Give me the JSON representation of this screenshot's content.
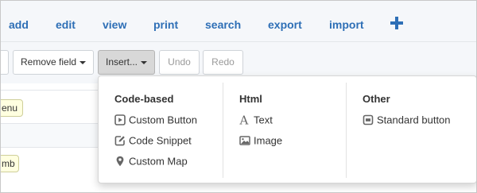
{
  "nav": {
    "items": [
      {
        "label": "add"
      },
      {
        "label": "edit"
      },
      {
        "label": "view"
      },
      {
        "label": "print"
      },
      {
        "label": "search"
      },
      {
        "label": "export"
      },
      {
        "label": "import"
      }
    ],
    "plus_icon": "plus-icon"
  },
  "toolbar": {
    "remove_field_label": "Remove field",
    "insert_label": "Insert...",
    "undo_label": "Undo",
    "redo_label": "Redo"
  },
  "background": {
    "pill1": "enu",
    "pill2": "mb"
  },
  "dropdown": {
    "columns": [
      {
        "header": "Code-based",
        "items": [
          {
            "label": "Custom Button",
            "icon": "play-square-icon"
          },
          {
            "label": "Code Snippet",
            "icon": "edit-icon"
          },
          {
            "label": "Custom Map",
            "icon": "map-marker-icon"
          }
        ]
      },
      {
        "header": "Html",
        "items": [
          {
            "label": "Text",
            "icon": "font-icon"
          },
          {
            "label": "Image",
            "icon": "picture-icon"
          }
        ]
      },
      {
        "header": "Other",
        "items": [
          {
            "label": "Standard button",
            "icon": "button-icon"
          }
        ]
      }
    ]
  },
  "colors": {
    "nav_link": "#2e6fb6",
    "menu_icon": "#666666",
    "pill_bg": "#ffffe0"
  }
}
